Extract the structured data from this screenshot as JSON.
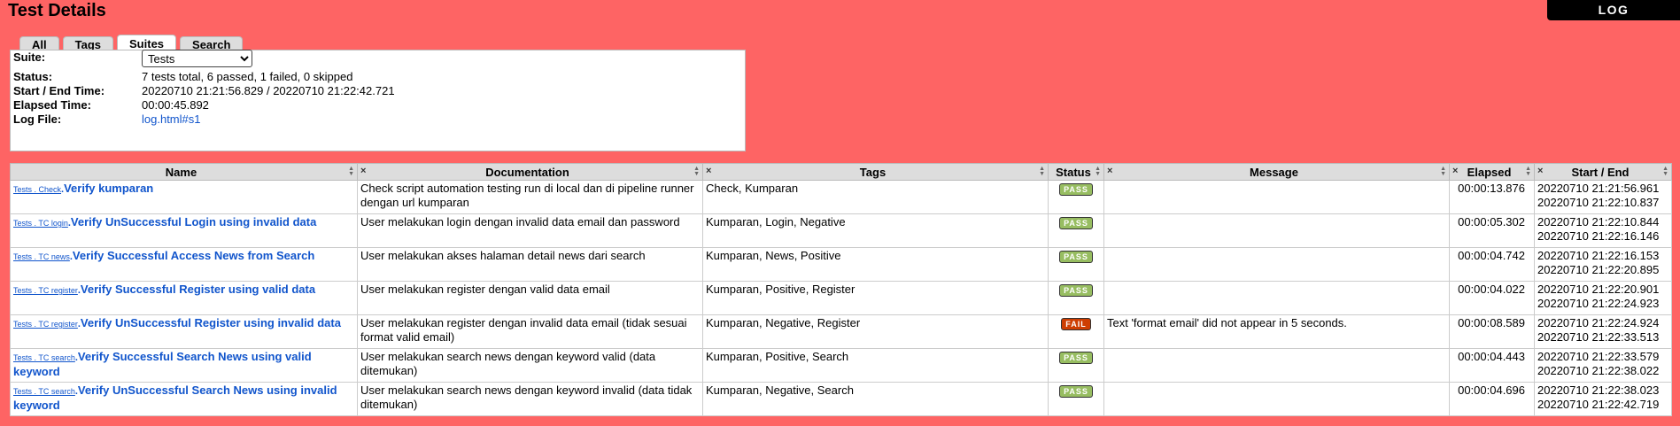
{
  "header": {
    "title": "Test Details",
    "log_button": "LOG"
  },
  "tabs": [
    {
      "label": "All",
      "selected": false
    },
    {
      "label": "Tags",
      "selected": false
    },
    {
      "label": "Suites",
      "selected": true
    },
    {
      "label": "Search",
      "selected": false
    }
  ],
  "details": {
    "suite_label": "Suite:",
    "suite_value": "Tests",
    "status_label": "Status:",
    "status_value": "7 tests total, 6 passed, 1 failed, 0 skipped",
    "startend_label": "Start / End Time:",
    "startend_value": "20220710 21:21:56.829 / 20220710 21:22:42.721",
    "elapsed_label": "Elapsed Time:",
    "elapsed_value": "00:00:45.892",
    "logfile_label": "Log File:",
    "logfile_value": "log.html#s1"
  },
  "table": {
    "headers": {
      "name": "Name",
      "documentation": "Documentation",
      "tags": "Tags",
      "status": "Status",
      "message": "Message",
      "elapsed": "Elapsed",
      "startend": "Start / End"
    },
    "close_icon": "×",
    "sort_icon": "▲▼",
    "rows": [
      {
        "parent": "Tests . Check",
        "sep": ".",
        "name": "Verify kumparan",
        "doc": "Check script automation testing run di local dan di pipeline runner dengan url kumparan",
        "tags": "Check, Kumparan",
        "status": "PASS",
        "message": "",
        "elapsed": "00:00:13.876",
        "start": "20220710 21:21:56.961",
        "end": "20220710 21:22:10.837"
      },
      {
        "parent": "Tests . TC login",
        "sep": ".",
        "name": "Verify UnSuccessful Login using invalid data",
        "doc": "User melakukan login dengan invalid data email dan password",
        "tags": "Kumparan, Login, Negative",
        "status": "PASS",
        "message": "",
        "elapsed": "00:00:05.302",
        "start": "20220710 21:22:10.844",
        "end": "20220710 21:22:16.146"
      },
      {
        "parent": "Tests . TC news",
        "sep": ".",
        "name": "Verify Successful Access News from Search",
        "doc": "User melakukan akses halaman detail news dari search",
        "tags": "Kumparan, News, Positive",
        "status": "PASS",
        "message": "",
        "elapsed": "00:00:04.742",
        "start": "20220710 21:22:16.153",
        "end": "20220710 21:22:20.895"
      },
      {
        "parent": "Tests . TC register",
        "sep": ".",
        "name": "Verify Successful Register using valid data",
        "doc": "User melakukan register dengan valid data email",
        "tags": "Kumparan, Positive, Register",
        "status": "PASS",
        "message": "",
        "elapsed": "00:00:04.022",
        "start": "20220710 21:22:20.901",
        "end": "20220710 21:22:24.923"
      },
      {
        "parent": "Tests . TC register",
        "sep": ".",
        "name": "Verify UnSuccessful Register using invalid data",
        "doc": "User melakukan register dengan invalid data email (tidak sesuai format valid email)",
        "tags": "Kumparan, Negative, Register",
        "status": "FAIL",
        "message": "Text 'format email' did not appear in 5 seconds.",
        "elapsed": "00:00:08.589",
        "start": "20220710 21:22:24.924",
        "end": "20220710 21:22:33.513"
      },
      {
        "parent": "Tests . TC search",
        "sep": ".",
        "name": "Verify Successful Search News using valid keyword",
        "doc": "User melakukan search news dengan keyword valid (data ditemukan)",
        "tags": "Kumparan, Positive, Search",
        "status": "PASS",
        "message": "",
        "elapsed": "00:00:04.443",
        "start": "20220710 21:22:33.579",
        "end": "20220710 21:22:38.022"
      },
      {
        "parent": "Tests . TC search",
        "sep": ".",
        "name": "Verify UnSuccessful Search News using invalid keyword",
        "doc": "User melakukan search news dengan keyword invalid (data tidak ditemukan)",
        "tags": "Kumparan, Negative, Search",
        "status": "PASS",
        "message": "",
        "elapsed": "00:00:04.696",
        "start": "20220710 21:22:38.023",
        "end": "20220710 21:22:42.719"
      }
    ]
  },
  "colors": {
    "background": "#fe6464",
    "pass": "#97bd61",
    "fail": "#ce3e01",
    "link": "#1155cc"
  }
}
